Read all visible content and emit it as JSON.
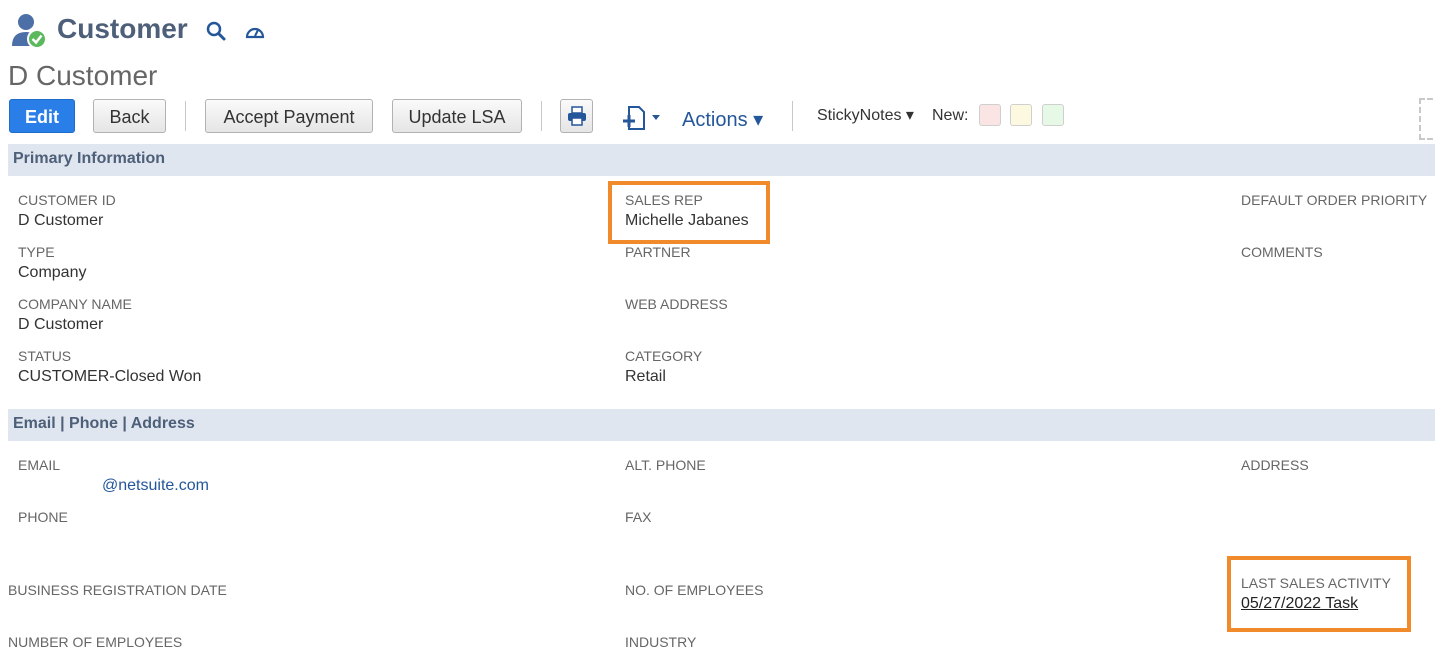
{
  "header": {
    "record_type": "Customer",
    "record_name": "D Customer"
  },
  "toolbar": {
    "edit_label": "Edit",
    "back_label": "Back",
    "accept_payment_label": "Accept Payment",
    "update_lsa_label": "Update LSA",
    "actions_label": "Actions ▾",
    "stickynotes_label": "StickyNotes ▾",
    "new_label": "New:"
  },
  "sections": {
    "primary": {
      "title": "Primary Information",
      "customer_id_label": "CUSTOMER ID",
      "customer_id_value": "D Customer",
      "type_label": "TYPE",
      "type_value": "Company",
      "company_name_label": "COMPANY NAME",
      "company_name_value": "D Customer",
      "status_label": "STATUS",
      "status_value": "CUSTOMER-Closed Won",
      "sales_rep_label": "SALES REP",
      "sales_rep_value": "Michelle Jabanes",
      "partner_label": "PARTNER",
      "web_address_label": "WEB ADDRESS",
      "category_label": "CATEGORY",
      "category_value": "Retail",
      "default_order_priority_label": "DEFAULT ORDER PRIORITY",
      "comments_label": "COMMENTS"
    },
    "contact": {
      "title": "Email | Phone | Address",
      "email_label": "EMAIL",
      "email_value": "@netsuite.com",
      "phone_label": "PHONE",
      "alt_phone_label": "ALT. PHONE",
      "fax_label": "FAX",
      "address_label": "ADDRESS"
    },
    "misc": {
      "business_registration_date_label": "BUSINESS REGISTRATION DATE",
      "no_of_employees_label": "NO. OF EMPLOYEES",
      "last_sales_activity_label": "LAST SALES ACTIVITY",
      "last_sales_activity_value": "05/27/2022 Task",
      "number_of_employees_label": "NUMBER OF EMPLOYEES",
      "industry_label": "INDUSTRY"
    }
  },
  "colors": {
    "accent_blue": "#2a7ee8",
    "section_bg": "#e0e6ef",
    "highlight_orange": "#f08a2b"
  }
}
